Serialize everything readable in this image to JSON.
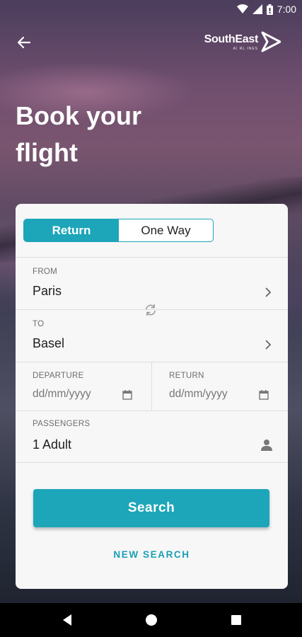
{
  "status_bar": {
    "time": "7:00",
    "icons": [
      "wifi-icon",
      "signal-icon",
      "battery-icon"
    ]
  },
  "header": {
    "back_icon": "arrow-left-icon",
    "brand_name": "SouthEast",
    "brand_tagline": "AI RL INES",
    "brand_icon": "paper-plane-icon"
  },
  "headline": {
    "line1": "Book your",
    "line2": "flight"
  },
  "trip_type": {
    "options": [
      "Return",
      "One Way"
    ],
    "selected": "Return"
  },
  "from": {
    "label": "FROM",
    "value": "Paris"
  },
  "to": {
    "label": "TO",
    "value": "Basel"
  },
  "swap_icon": "swap-refresh-icon",
  "departure": {
    "label": "DEPARTURE",
    "placeholder": "dd/mm/yyyy"
  },
  "return": {
    "label": "RETURN",
    "placeholder": "dd/mm/yyyy"
  },
  "passengers": {
    "label": "PASSENGERS",
    "value": "1 Adult"
  },
  "actions": {
    "search_label": "Search",
    "new_search_label": "NEW SEARCH"
  },
  "colors": {
    "accent": "#1da5b9",
    "card": "#f7f7f8",
    "nav": "#000000"
  },
  "nav_bar": {
    "buttons": [
      "back-triangle-icon",
      "home-circle-icon",
      "recents-square-icon"
    ]
  }
}
